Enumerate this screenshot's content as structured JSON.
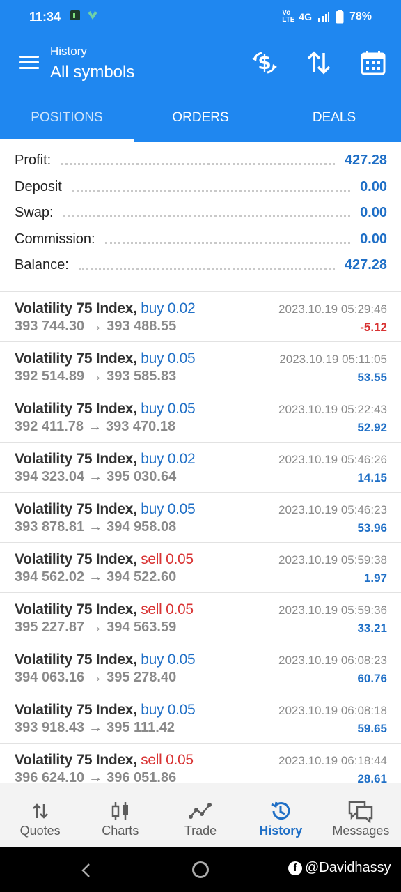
{
  "status_bar": {
    "time": "11:34",
    "network_label": "4G",
    "volte_label": "Vo LTE",
    "battery": "78%"
  },
  "header": {
    "subtitle": "History",
    "title": "All symbols"
  },
  "tabs": [
    {
      "label": "POSITIONS",
      "active": true
    },
    {
      "label": "ORDERS",
      "active": false
    },
    {
      "label": "DEALS",
      "active": false
    }
  ],
  "summary": {
    "profit_label": "Profit:",
    "profit_value": "427.28",
    "deposit_label": "Deposit",
    "deposit_value": "0.00",
    "swap_label": "Swap:",
    "swap_value": "0.00",
    "commission_label": "Commission:",
    "commission_value": "0.00",
    "balance_label": "Balance:",
    "balance_value": "427.28"
  },
  "deals": [
    {
      "symbol": "Volatility 75 Index,",
      "side": "buy 0.02",
      "open": "393 744.30",
      "close": "393 488.55",
      "date": "2023.10.19 05:29:46",
      "profit": "-5.12"
    },
    {
      "symbol": "Volatility 75 Index,",
      "side": "buy 0.05",
      "open": "392 514.89",
      "close": "393 585.83",
      "date": "2023.10.19 05:11:05",
      "profit": "53.55"
    },
    {
      "symbol": "Volatility 75 Index,",
      "side": "buy 0.05",
      "open": "392 411.78",
      "close": "393 470.18",
      "date": "2023.10.19 05:22:43",
      "profit": "52.92"
    },
    {
      "symbol": "Volatility 75 Index,",
      "side": "buy 0.02",
      "open": "394 323.04",
      "close": "395 030.64",
      "date": "2023.10.19 05:46:26",
      "profit": "14.15"
    },
    {
      "symbol": "Volatility 75 Index,",
      "side": "buy 0.05",
      "open": "393 878.81",
      "close": "394 958.08",
      "date": "2023.10.19 05:46:23",
      "profit": "53.96"
    },
    {
      "symbol": "Volatility 75 Index,",
      "side": "sell 0.05",
      "open": "394 562.02",
      "close": "394 522.60",
      "date": "2023.10.19 05:59:38",
      "profit": "1.97"
    },
    {
      "symbol": "Volatility 75 Index,",
      "side": "sell 0.05",
      "open": "395 227.87",
      "close": "394 563.59",
      "date": "2023.10.19 05:59:36",
      "profit": "33.21"
    },
    {
      "symbol": "Volatility 75 Index,",
      "side": "buy 0.05",
      "open": "394 063.16",
      "close": "395 278.40",
      "date": "2023.10.19 06:08:23",
      "profit": "60.76"
    },
    {
      "symbol": "Volatility 75 Index,",
      "side": "buy 0.05",
      "open": "393 918.43",
      "close": "395 111.42",
      "date": "2023.10.19 06:08:18",
      "profit": "59.65"
    },
    {
      "symbol": "Volatility 75 Index,",
      "side": "sell 0.05",
      "open": "396 624.10",
      "close": "396 051.86",
      "date": "2023.10.19 06:18:44",
      "profit": "28.61"
    }
  ],
  "arrow": "→",
  "bottom_nav": [
    {
      "label": "Quotes",
      "icon": "quotes-icon"
    },
    {
      "label": "Charts",
      "icon": "charts-icon"
    },
    {
      "label": "Trade",
      "icon": "trade-icon"
    },
    {
      "label": "History",
      "icon": "history-icon",
      "active": true
    },
    {
      "label": "Messages",
      "icon": "messages-icon"
    }
  ],
  "watermark": "@Davidhassy",
  "colors": {
    "brand": "#1f87f0",
    "buy": "#1f6fc6",
    "sell": "#d83232"
  }
}
